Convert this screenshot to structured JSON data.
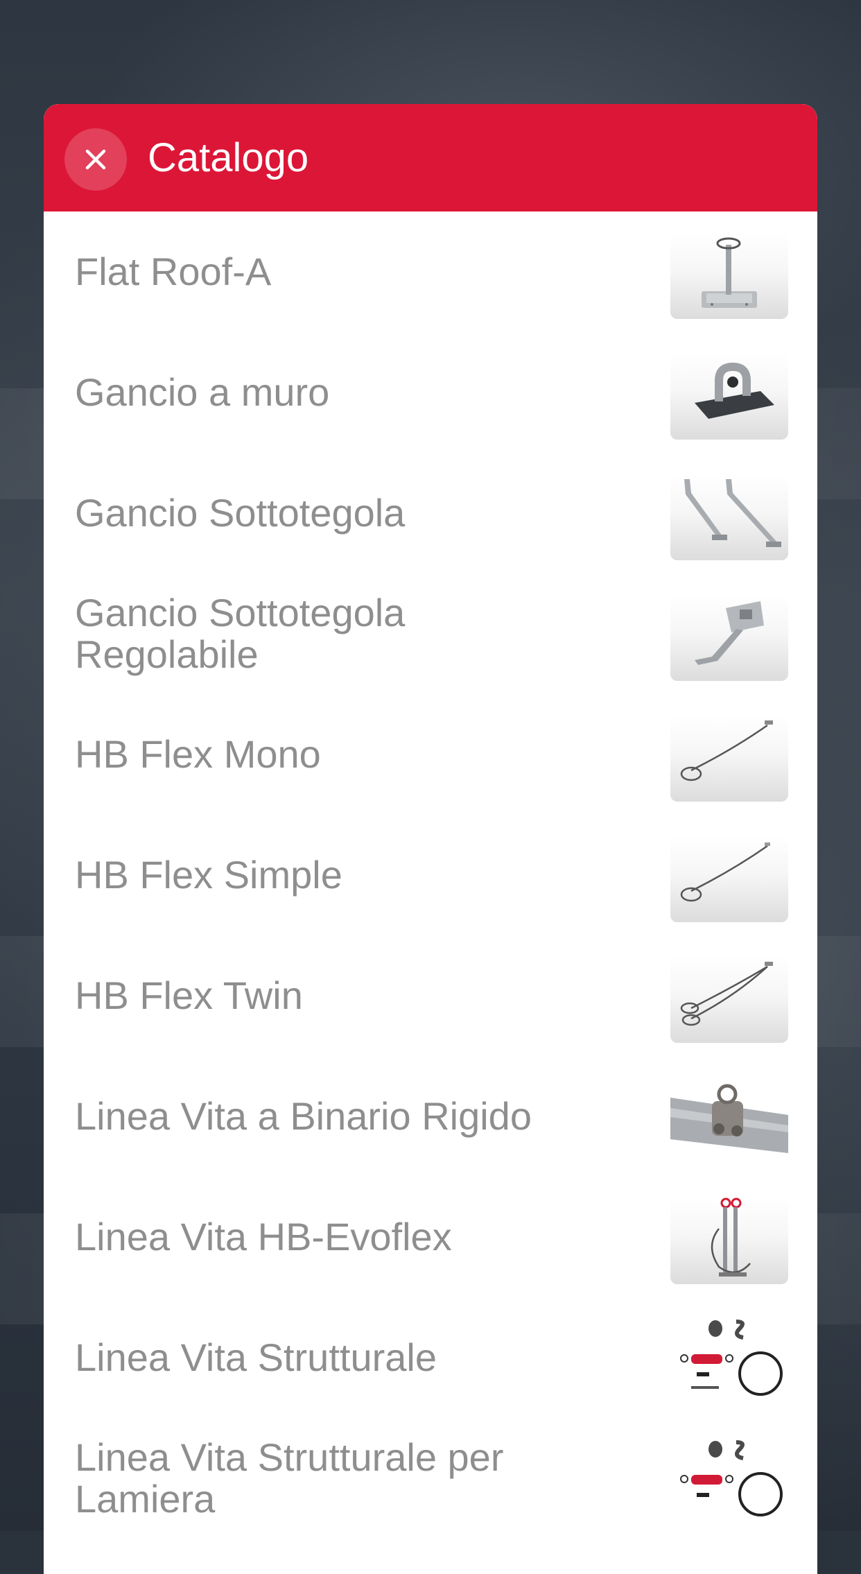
{
  "header": {
    "title": "Catalogo",
    "close_icon": "close-icon"
  },
  "colors": {
    "header_bg": "#dc1637",
    "label_text": "#8e8e8e"
  },
  "items": [
    {
      "label": "Flat Roof-A",
      "icon": "flat-roof-anchor-image"
    },
    {
      "label": "Gancio a muro",
      "icon": "wall-hook-image"
    },
    {
      "label": "Gancio Sottotegola",
      "icon": "under-tile-hook-image"
    },
    {
      "label": "Gancio Sottotegola Regolabile",
      "icon": "adjustable-under-tile-hook-image"
    },
    {
      "label": "HB Flex Mono",
      "icon": "cable-sling-mono-image"
    },
    {
      "label": "HB Flex Simple",
      "icon": "cable-sling-simple-image"
    },
    {
      "label": "HB Flex Twin",
      "icon": "cable-sling-twin-image"
    },
    {
      "label": "Linea Vita a Binario Rigido",
      "icon": "rigid-rail-lifeline-image"
    },
    {
      "label": "Linea Vita HB-Evoflex",
      "icon": "evoflex-lifeline-image"
    },
    {
      "label": "Linea Vita Strutturale",
      "icon": "structural-lifeline-kit-image"
    },
    {
      "label": "Linea Vita Strutturale per Lamiera",
      "icon": "structural-lifeline-sheet-kit-image"
    }
  ]
}
